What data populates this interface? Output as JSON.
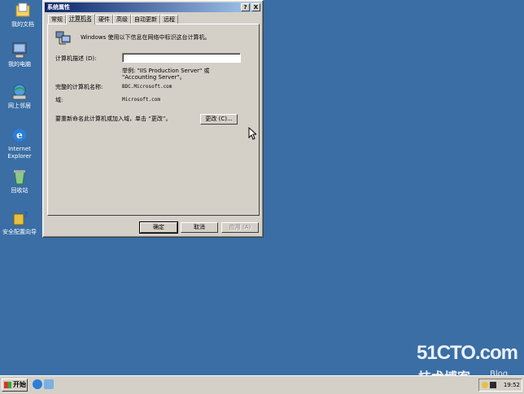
{
  "desktop": {
    "icons": [
      {
        "label": "我的文档",
        "icon": "my-documents-icon"
      },
      {
        "label": "我的电脑",
        "icon": "my-computer-icon"
      },
      {
        "label": "网上邻居",
        "icon": "network-places-icon"
      },
      {
        "label": "Internet",
        "label2": "Explorer",
        "icon": "internet-explorer-icon"
      },
      {
        "label": "回收站",
        "icon": "recycle-bin-icon"
      },
      {
        "label": "安全配置向导",
        "icon": "security-wizard-icon"
      }
    ]
  },
  "dialog": {
    "title": "系统属性",
    "help_btn": "?",
    "close_btn": "X",
    "tabs": [
      "常规",
      "计算机名",
      "硬件",
      "高级",
      "自动更新",
      "远程"
    ],
    "active_tab": "计算机名",
    "intro": "Windows 使用以下信息在网络中标识这台计算机。",
    "desc_label": "计算机描述 (D):",
    "desc_value": "",
    "example_line1": "举例: \"IIS Production Server\" 或",
    "example_line2": "\"Accounting Server\"。",
    "fullname_label": "完整的计算机名称:",
    "fullname_value": "BDC.Microsoft.com",
    "domain_label": "域:",
    "domain_value": "Microsoft.com",
    "rename_text": "要重新命名此计算机或加入域，单击 “更改”。",
    "change_btn": "更改 (C)...",
    "ok_btn": "确定",
    "cancel_btn": "取消",
    "apply_btn": "应用 (A)"
  },
  "taskbar": {
    "start_label": "开始",
    "clock": "19:52"
  },
  "watermark": {
    "brand": "51CTO.com",
    "sub": "技术博客",
    "blog": "Blog"
  }
}
